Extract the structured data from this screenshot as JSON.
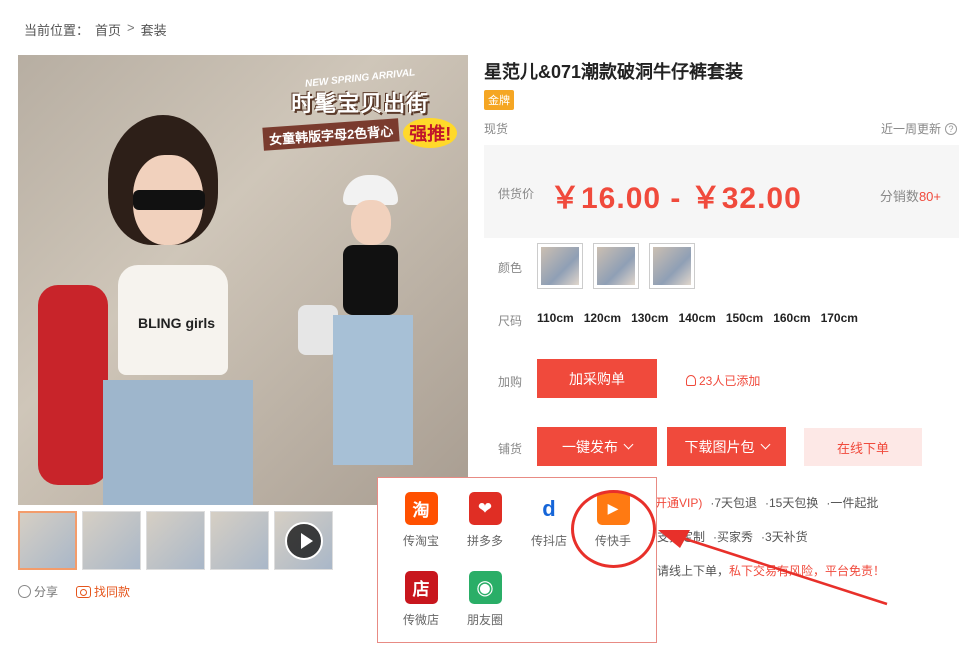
{
  "breadcrumb": {
    "label": "当前位置：",
    "home": "首页",
    "sep": ">",
    "current": "套装"
  },
  "main_image": {
    "banner_small": "NEW SPRING ARRIVAL",
    "banner_big": "时髦宝贝出街",
    "banner_sub": "女童韩版字母2色背心",
    "banner_strong": "强推!",
    "shirt_text": "BLING girls"
  },
  "share": {
    "share_label": "分享",
    "find_label": "找同款"
  },
  "product": {
    "title": "星范儿&071潮款破洞牛仔裤套装",
    "badge": "金牌",
    "stock": "现货",
    "updated": "近一周更新",
    "price_label": "供货价",
    "price_range": "￥16.00 - ￥32.00",
    "dist_label": "分销数",
    "dist_count": "80+"
  },
  "options": {
    "color_label": "颜色",
    "size_label": "尺码",
    "sizes": [
      "110cm",
      "120cm",
      "130cm",
      "140cm",
      "150cm",
      "160cm",
      "170cm"
    ],
    "purchase_label": "加购",
    "add_cart": "加采购单",
    "added_count": "23人已添加",
    "shop_label": "铺货",
    "publish": "一键发布",
    "download": "下载图片包",
    "online_order": "在线下单"
  },
  "dropdown": {
    "items": [
      {
        "label": "传淘宝",
        "glyph": "淘",
        "color": "#ff5000"
      },
      {
        "label": "拼多多",
        "glyph": "❤",
        "color": "#e02e24"
      },
      {
        "label": "传抖店",
        "glyph": "d",
        "color": "#1565d8"
      },
      {
        "label": "传快手",
        "glyph": "▶",
        "color": "#ff7a12"
      },
      {
        "label": "传微店",
        "glyph": "店",
        "color": "#c8161d"
      },
      {
        "label": "朋友圈",
        "glyph": "◉",
        "color": "#2aae67"
      }
    ]
  },
  "services": {
    "vip": "开通VIP)",
    "items": [
      "·7天包退",
      "·15天包换",
      "·一件起批"
    ],
    "items2": [
      "支持定制",
      "·买家秀",
      "·3天补货"
    ],
    "warning_prefix": "请线上下单，",
    "warning_red": "私下交易有风险，平台免责！"
  },
  "colors": {
    "accent": "#f04a3c",
    "gold": "#f5a623"
  }
}
